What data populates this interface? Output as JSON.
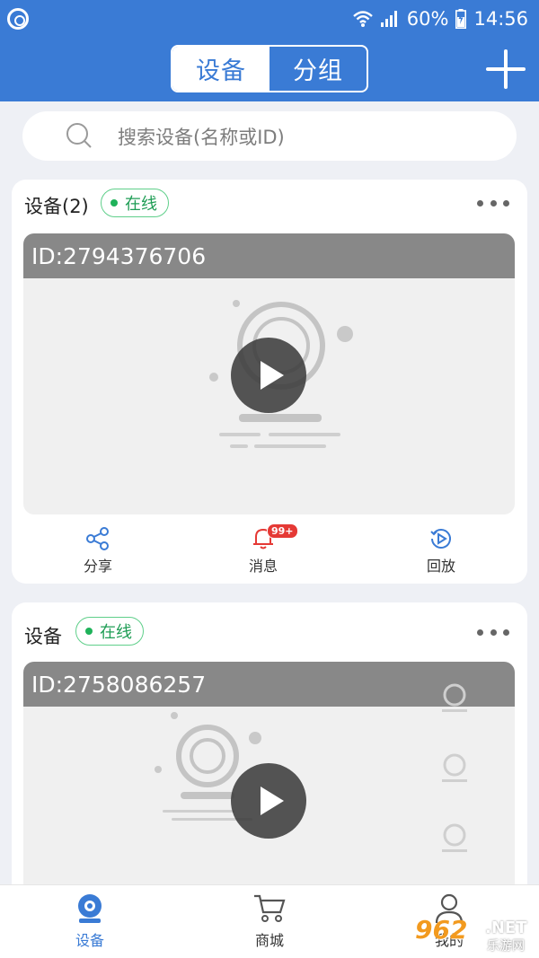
{
  "status_bar": {
    "battery": "60%",
    "time": "14:56"
  },
  "header": {
    "tabs": [
      {
        "label": "设备",
        "active": true
      },
      {
        "label": "分组",
        "active": false
      }
    ],
    "accent_color": "#3a7bd5"
  },
  "search": {
    "placeholder": "搜索设备(名称或ID)"
  },
  "devices": [
    {
      "name": "设备(2)",
      "status": "在线",
      "id_label": "ID:2794376706",
      "actions": [
        {
          "label": "分享",
          "icon": "share-icon"
        },
        {
          "label": "消息",
          "icon": "bell-icon",
          "badge": "99+"
        },
        {
          "label": "回放",
          "icon": "playback-icon"
        }
      ]
    },
    {
      "name": "设备",
      "status": "在线",
      "id_label": "ID:2758086257"
    }
  ],
  "bottom_nav": [
    {
      "label": "设备",
      "icon": "camera-icon",
      "active": true
    },
    {
      "label": "商城",
      "icon": "cart-icon",
      "active": false
    },
    {
      "label": "我的",
      "icon": "user-icon",
      "active": false
    }
  ],
  "watermark": {
    "number": "962",
    "domain": ".NET",
    "site": "乐游网"
  }
}
